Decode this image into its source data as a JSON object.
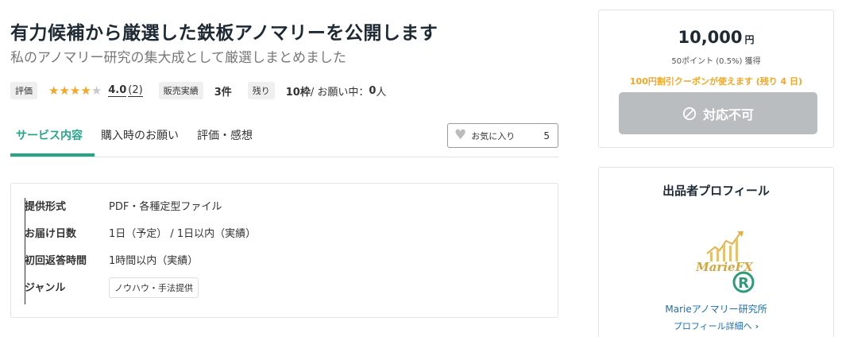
{
  "header": {
    "title": "有力候補から厳選した鉄板アノマリーを公開します",
    "subtitle": "私のアノマリー研究の集大成として厳選しまとめました"
  },
  "meta": {
    "rating_label": "評価",
    "stars_filled": 4,
    "stars_total": 5,
    "rating_value": "4.0",
    "rating_count": "(2)",
    "sales_label": "販売実績",
    "sales_value": "3件",
    "remain_label": "残り",
    "remain_value": "10枠",
    "remain_sep": " / お願い中：",
    "requesting_value": "0",
    "requesting_unit": "人"
  },
  "tabs": [
    {
      "label": "サービス内容",
      "active": true
    },
    {
      "label": "購入時のお願い",
      "active": false
    },
    {
      "label": "評価・感想",
      "active": false
    }
  ],
  "favorite": {
    "label": "お気に入り",
    "count": "5"
  },
  "details": [
    {
      "label": "提供形式",
      "value": "PDF・各種定型ファイル"
    },
    {
      "label": "お届け日数",
      "value": "1日（予定） / 1日以内（実績）"
    },
    {
      "label": "初回返答時間",
      "value": "1時間以内（実績）"
    },
    {
      "label": "ジャンル",
      "tag": "ノウハウ・手法提供"
    }
  ],
  "price_card": {
    "price": "10,000",
    "currency": "円",
    "points": "50ポイント (0.5%) 獲得",
    "coupon": "100円割引クーポンが使えます (残り 4 日)",
    "button_label": "対応不可"
  },
  "seller": {
    "section_title": "出品者プロフィール",
    "logo_text": "MarieFX",
    "name": "Marieアノマリー研究所",
    "profile_link": "プロフィール詳細へ"
  },
  "colors": {
    "accent": "#27a589",
    "star": "#f5a623",
    "coupon": "#f5a623",
    "link": "#1a6fb5",
    "disabled_button": "#b9bdbf"
  }
}
